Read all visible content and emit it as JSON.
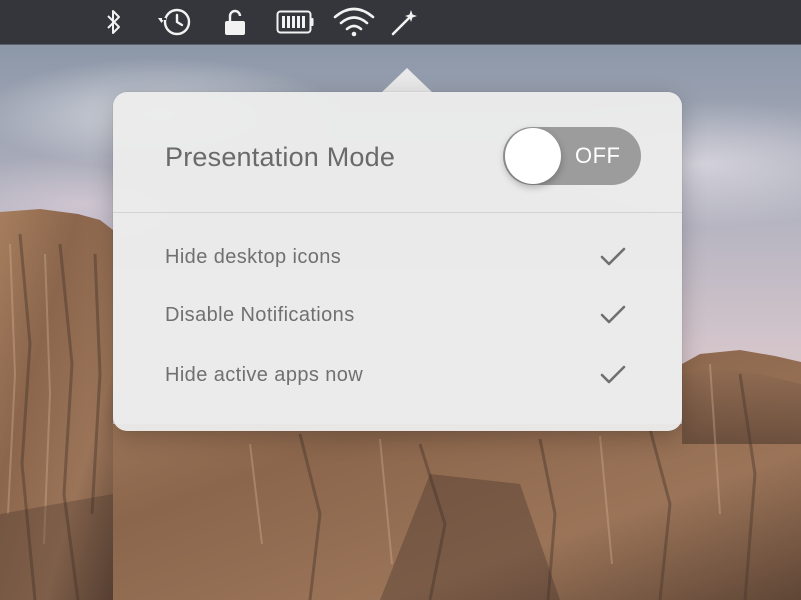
{
  "menubar": {
    "icons": [
      {
        "name": "bluetooth-icon"
      },
      {
        "name": "time-machine-icon"
      },
      {
        "name": "lock-icon"
      },
      {
        "name": "battery-icon"
      },
      {
        "name": "wifi-icon"
      },
      {
        "name": "magic-wand-icon"
      }
    ]
  },
  "popover": {
    "title": "Presentation Mode",
    "toggle": {
      "state_label": "OFF",
      "on": false
    },
    "options": [
      {
        "label": "Hide desktop icons",
        "checked": true
      },
      {
        "label": "Disable Notifications",
        "checked": true
      },
      {
        "label": "Hide active apps now",
        "checked": true
      }
    ]
  },
  "colors": {
    "menubar": "#34363c",
    "popover_bg": "#ececec",
    "toggle_off": "#9c9c9c",
    "text": "#6a6a6a"
  }
}
